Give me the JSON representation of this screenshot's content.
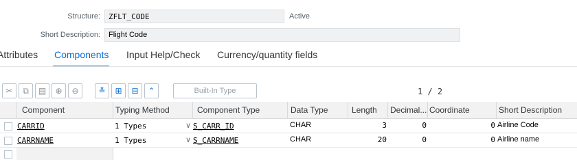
{
  "header": {
    "structure_label": "Structure:",
    "structure_value": "ZFLT_CODE",
    "status": "Active",
    "short_desc_label": "Short Description:",
    "short_desc_value": "Flight Code"
  },
  "tabs": [
    {
      "label": "Attributes",
      "selected": false
    },
    {
      "label": "Components",
      "selected": true
    },
    {
      "label": "Input Help/Check",
      "selected": false
    },
    {
      "label": "Currency/quantity fields",
      "selected": false
    }
  ],
  "toolbar": {
    "icons": [
      "cut-icon",
      "copy-icon",
      "paste-icon",
      "insert-row-icon",
      "delete-row-icon",
      "collapse-icon",
      "new-field-icon",
      "new-include-icon",
      "expand-up-icon"
    ],
    "builtin_type_label": "Built-In Type",
    "pager": "1 / 2"
  },
  "grid": {
    "columns": [
      "Component",
      "Typing Method",
      "Component Type",
      "Data Type",
      "Length",
      "Decimal...",
      "Coordinate",
      "Short Description"
    ],
    "rows": [
      {
        "component": "CARRID",
        "typing": "1 Types",
        "comp_type": "S_CARR_ID",
        "data_type": "CHAR",
        "length": "3",
        "decimals": "0",
        "coordinate": "0",
        "desc": "Airline Code"
      },
      {
        "component": "CARRNAME",
        "typing": "1 Types",
        "comp_type": "S_CARRNAME",
        "data_type": "CHAR",
        "length": "20",
        "decimals": "0",
        "coordinate": "0",
        "desc": "Airline name"
      }
    ]
  },
  "colors": {
    "accent": "#0a6ed1",
    "header_bg": "#f2f2f2",
    "field_bg": "#f0f1f2"
  }
}
